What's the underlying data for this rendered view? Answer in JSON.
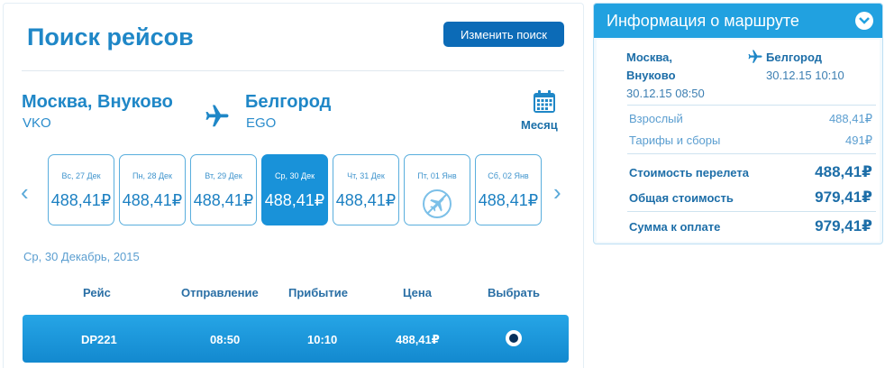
{
  "search": {
    "title": "Поиск рейсов",
    "change_button": "Изменить поиск",
    "origin_city": "Москва, Внуково",
    "origin_code": "VKO",
    "destination_city": "Белгород",
    "destination_code": "EGO",
    "month_label": "Месяц",
    "icons": [
      "plane-icon",
      "calendar-icon",
      "chevron-left-icon",
      "chevron-right-icon",
      "no-flight-icon"
    ]
  },
  "days": [
    {
      "label": "Вс, 27 Дек",
      "price": "488,41₽",
      "selected": false
    },
    {
      "label": "Пн, 28 Дек",
      "price": "488,41₽",
      "selected": false
    },
    {
      "label": "Вт, 29 Дек",
      "price": "488,41₽",
      "selected": false
    },
    {
      "label": "Ср, 30 Дек",
      "price": "488,41₽",
      "selected": true
    },
    {
      "label": "Чт, 31 Дек",
      "price": "488,41₽",
      "selected": false
    },
    {
      "label": "Пт, 01 Янв",
      "price": "",
      "selected": false
    },
    {
      "label": "Сб, 02 Янв",
      "price": "488,41₽",
      "selected": false
    }
  ],
  "selected_date": "Ср, 30 Декабрь, 2015",
  "table": {
    "headers": [
      "Рейс",
      "Отправление",
      "Прибытие",
      "Цена",
      "Выбрать"
    ],
    "rows": [
      {
        "flight": "DP221",
        "departure": "08:50",
        "arrival": "10:10",
        "price": "488,41₽",
        "selected": true
      }
    ]
  },
  "route_info": {
    "title": "Информация о маршруте",
    "from_line1": "Москва,",
    "from_line2": "Внуково",
    "from_datetime": "30.12.15 08:50",
    "to_city": "Белгород",
    "to_datetime": "30.12.15 10:10",
    "adult_label": "Взрослый",
    "adult_value": "488,41₽",
    "fees_label": "Тарифы и сборы",
    "fees_value": "491₽",
    "flight_cost_label": "Стоимость перелета",
    "flight_cost_value": "488,41₽",
    "total_label": "Общая стоимость",
    "total_value": "979,41₽",
    "payment_label": "Сумма к оплате",
    "payment_value": "979,41₽"
  },
  "colors": {
    "accent": "#1f87c7",
    "button": "#0c6bb7",
    "selected_day": "#1992d9",
    "row": "#1a98dc",
    "panel_header": "#21a1e0"
  }
}
